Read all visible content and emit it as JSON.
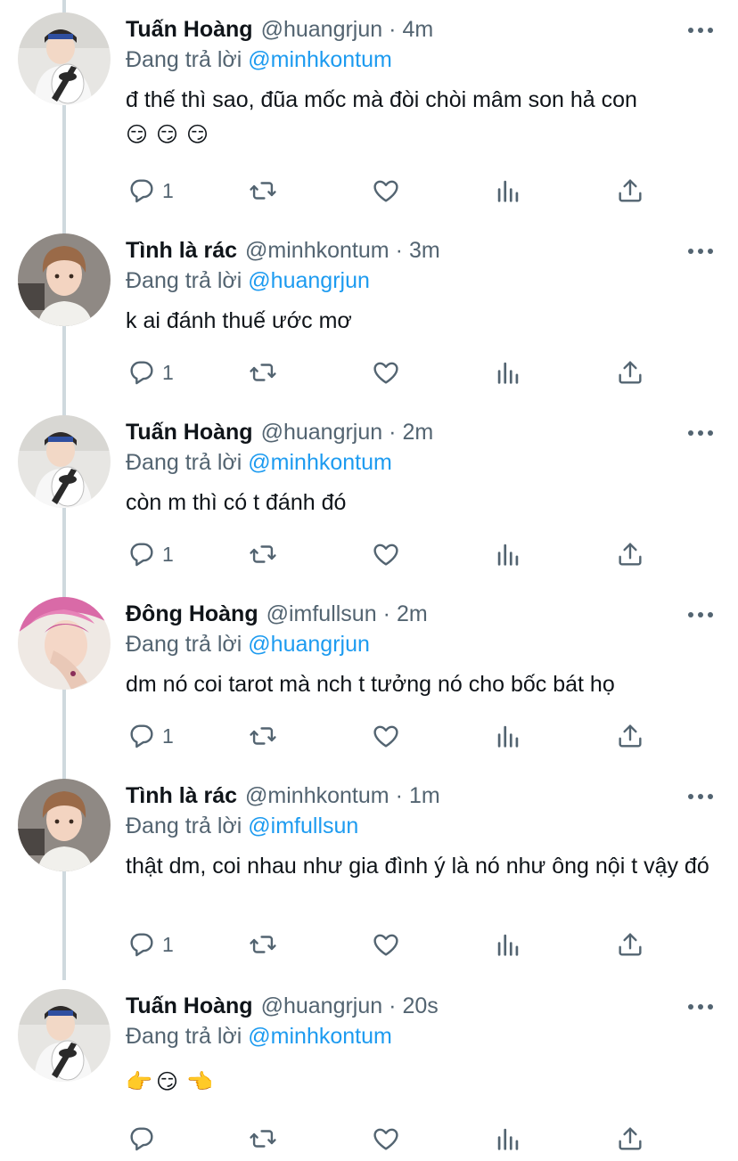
{
  "reply_prefix": "Đang trả lời",
  "tweets": [
    {
      "name": "Tuấn Hoàng",
      "handle": "@huangrjun",
      "time": "4m",
      "reply_to": "@minhkontum",
      "text": "đ thế thì sao, đũa mốc mà đòi chòi mâm son hả con",
      "emojis": [
        "😏",
        "😏",
        "😏"
      ],
      "reply_count": "1",
      "avatar": "person-with-plush-toy"
    },
    {
      "name": "Tình là rác",
      "handle": "@minhkontum",
      "time": "3m",
      "reply_to": "@huangrjun",
      "text": "k ai đánh thuế ước mơ",
      "emojis": [],
      "reply_count": "1",
      "avatar": "person-brown-hair"
    },
    {
      "name": "Tuấn Hoàng",
      "handle": "@huangrjun",
      "time": "2m",
      "reply_to": "@minhkontum",
      "text": "còn m thì có t đánh đó",
      "emojis": [],
      "reply_count": "1",
      "avatar": "person-with-plush-toy"
    },
    {
      "name": "Đông Hoàng",
      "handle": "@imfullsun",
      "time": "2m",
      "reply_to": "@huangrjun",
      "text": "dm nó coi tarot mà nch t tưởng nó cho bốc bát họ",
      "emojis": [],
      "reply_count": "1",
      "avatar": "person-pink-hair"
    },
    {
      "name": "Tình là rác",
      "handle": "@minhkontum",
      "time": "1m",
      "reply_to": "@imfullsun",
      "text": "thật dm, coi nhau như gia đình ý là nó như ông nội t vậy đó",
      "emojis": [],
      "reply_count": "1",
      "avatar": "person-brown-hair"
    },
    {
      "name": "Tuấn Hoàng",
      "handle": "@huangrjun",
      "time": "20s",
      "reply_to": "@minhkontum",
      "text": "",
      "emojis": [
        "👉",
        "😏",
        "👈"
      ],
      "reply_count": "",
      "avatar": "person-with-plush-toy"
    }
  ],
  "colors": {
    "text": "#0f1419",
    "secondary": "#536471",
    "link": "#1d9bf0",
    "thread_line": "#cfd9de"
  }
}
